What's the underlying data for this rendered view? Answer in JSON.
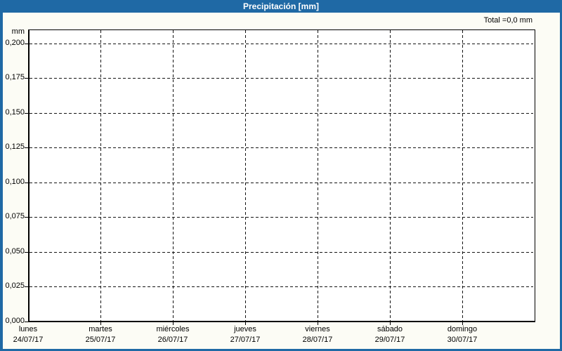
{
  "header": {
    "title": "Precipitación [mm]",
    "total_label": "Total =0,0 mm"
  },
  "colors": {
    "title_bar_bg": "#1F69A5",
    "title_text": "#FFFFFF",
    "window_border": "#1F69A5",
    "background": "#FCFCF5",
    "plot_background": "#FFFFFF",
    "grid": "#141414",
    "text": "#000000"
  },
  "chart_data": {
    "type": "bar",
    "title": "Precipitación [mm]",
    "xlabel": "",
    "ylabel": "mm",
    "categories": [
      "24/07/17",
      "25/07/17",
      "26/07/17",
      "27/07/17",
      "28/07/17",
      "29/07/17",
      "30/07/17"
    ],
    "day_names": [
      "lunes",
      "martes",
      "miércoles",
      "jueves",
      "viernes",
      "sábado",
      "domingo"
    ],
    "values": [
      0,
      0,
      0,
      0,
      0,
      0,
      0
    ],
    "total_mm": 0.0,
    "ylim": [
      0,
      0.21
    ],
    "y_ticks": [
      {
        "label": "0,200",
        "value": 0.2
      },
      {
        "label": "0,175",
        "value": 0.175
      },
      {
        "label": "0,150",
        "value": 0.15
      },
      {
        "label": "0,125",
        "value": 0.125
      },
      {
        "label": "0,100",
        "value": 0.1
      },
      {
        "label": "0,075",
        "value": 0.075
      },
      {
        "label": "0,050",
        "value": 0.05
      },
      {
        "label": "0,025",
        "value": 0.025
      },
      {
        "label": "0,000",
        "value": 0.0
      }
    ],
    "grid": "dashed",
    "legend": "none"
  }
}
